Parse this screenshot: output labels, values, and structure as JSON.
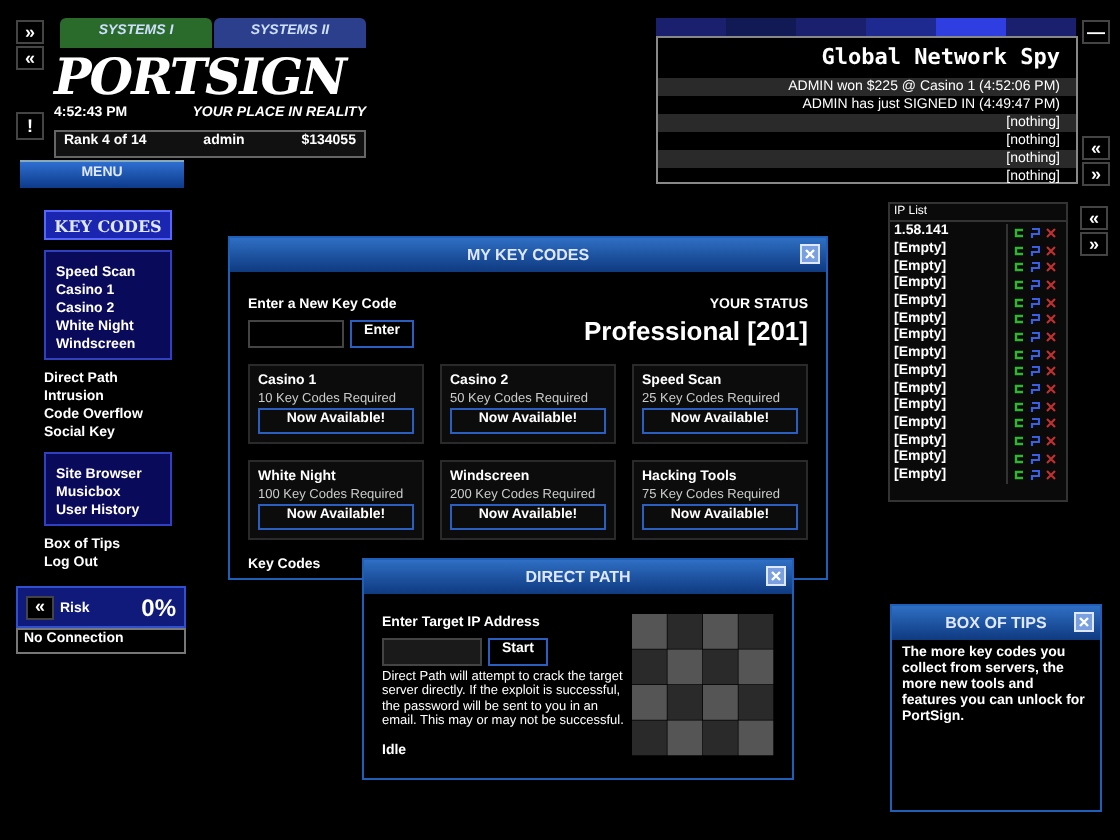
{
  "side_buttons": [
    "»",
    "«",
    "!"
  ],
  "tabs": [
    {
      "label": "SYSTEMS I",
      "color": "#2a6a2a"
    },
    {
      "label": "SYSTEMS II",
      "color": "#2b3f8c"
    }
  ],
  "logo": {
    "text": "PORTSIGN",
    "tagline": "YOUR PLACE IN REALITY"
  },
  "clock": "4:52:43 PM",
  "user_bar": {
    "rank": "Rank 4 of 14",
    "user": "admin",
    "money": "$134055"
  },
  "menu_button": "MENU",
  "network_spy": {
    "title": "Global Network Spy",
    "rows": [
      "ADMIN won $225 @ Casino 1 (4:52:06 PM)",
      "ADMIN has just SIGNED IN (4:49:47 PM)",
      "[nothing]",
      "[nothing]",
      "[nothing]",
      "[nothing]"
    ],
    "buttons": [
      "—",
      "«",
      "»"
    ]
  },
  "sidebar": {
    "header": "KEY CODES",
    "groups": [
      {
        "kind": "box",
        "items": [
          "Speed Scan",
          "Casino 1",
          "Casino 2",
          "White Night",
          "Windscreen"
        ]
      },
      {
        "kind": "plain",
        "items": [
          "Direct Path",
          "Intrusion",
          "Code Overflow",
          "Social Key"
        ]
      },
      {
        "kind": "box",
        "items": [
          "Site Browser",
          "Musicbox",
          "User History"
        ]
      },
      {
        "kind": "plain",
        "items": [
          "Box of Tips",
          "Log Out"
        ]
      }
    ]
  },
  "risk": {
    "button": "«",
    "label": "Risk",
    "value": "0%",
    "status": "No Connection"
  },
  "key_codes_window": {
    "title": "MY KEY CODES",
    "entry_label": "Enter a New Key Code",
    "enter_button": "Enter",
    "status_label": "YOUR STATUS",
    "status": "Professional [201]",
    "footer": "Key Codes",
    "cards": [
      {
        "name": "Casino 1",
        "requirement": "10 Key Codes Required",
        "action": "Now Available!"
      },
      {
        "name": "Casino 2",
        "requirement": "50 Key Codes Required",
        "action": "Now Available!"
      },
      {
        "name": "Speed Scan",
        "requirement": "25 Key Codes Required",
        "action": "Now Available!"
      },
      {
        "name": "White Night",
        "requirement": "100 Key Codes Required",
        "action": "Now Available!"
      },
      {
        "name": "Windscreen",
        "requirement": "200 Key Codes Required",
        "action": "Now Available!"
      },
      {
        "name": "Hacking Tools",
        "requirement": "75 Key Codes Required",
        "action": "Now Available!"
      }
    ]
  },
  "direct_path_window": {
    "title": "DIRECT PATH",
    "ip_label": "Enter Target IP Address",
    "start_button": "Start",
    "description": "Direct Path will attempt to crack the target server directly. If the exploit is successful, the password will be sent to you in an email. This may or may not be successful.",
    "status": "Idle"
  },
  "ip_list": {
    "title": "IP List",
    "rows": [
      "1.58.141",
      "[Empty]",
      "[Empty]",
      "[Empty]",
      "[Empty]",
      "[Empty]",
      "[Empty]",
      "[Empty]",
      "[Empty]",
      "[Empty]",
      "[Empty]",
      "[Empty]",
      "[Empty]",
      "[Empty]",
      "[Empty]"
    ],
    "buttons": [
      "«",
      "»"
    ]
  },
  "tips_window": {
    "title": "BOX OF TIPS",
    "text": "The more key codes you collect from servers, the more new tools and features you can unlock for PortSign."
  }
}
